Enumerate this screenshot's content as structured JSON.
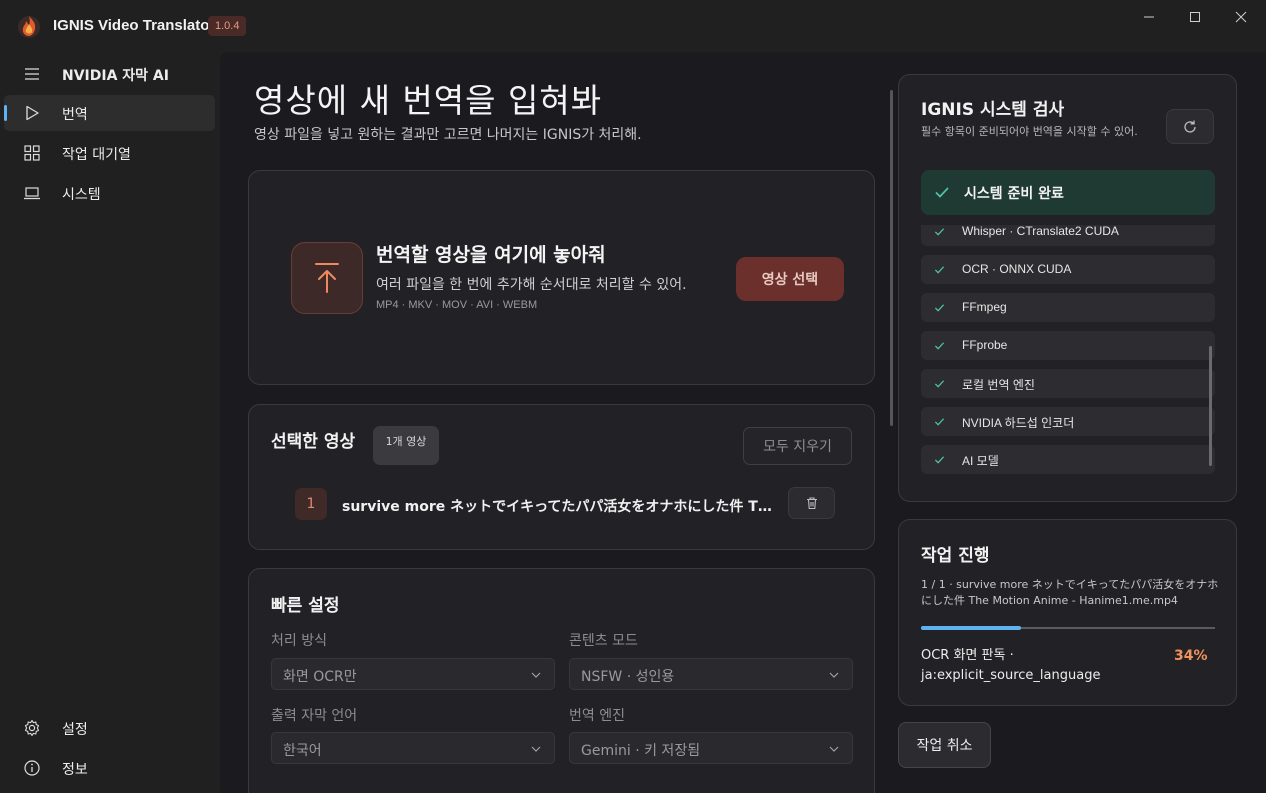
{
  "app": {
    "title": "IGNIS Video Translator",
    "version": "1.0.4"
  },
  "sidebar": {
    "header_label": "NVIDIA 자막 AI",
    "items": [
      {
        "label": "번역",
        "icon": "play-icon",
        "active": true
      },
      {
        "label": "작업 대기열",
        "icon": "grid-icon"
      },
      {
        "label": "시스템",
        "icon": "laptop-icon"
      }
    ],
    "footer": [
      {
        "label": "설정",
        "icon": "gear-icon"
      },
      {
        "label": "정보",
        "icon": "info-icon"
      }
    ]
  },
  "page": {
    "title": "영상에 새 번역을 입혀봐",
    "subtitle": "영상 파일을 넣고 원하는 결과만 고르면 나머지는 IGNIS가 처리해."
  },
  "dropzone": {
    "title": "번역할 영상을 여기에 놓아줘",
    "description": "여러 파일을 한 번에 추가해 순서대로 처리할 수 있어.",
    "formats": "MP4 · MKV · MOV · AVI · WEBM",
    "button": "영상 선택"
  },
  "selected": {
    "title": "선택한 영상",
    "count": "1개 영상",
    "clear_button": "모두 지우기",
    "files": [
      {
        "index": "1",
        "name": "survive more ネットでイキってたパパ活女をオナホにした件 The Motion Anime - Hanime1.me.mp4"
      }
    ]
  },
  "quick_settings": {
    "title": "빠른 설정",
    "fields": [
      {
        "label": "처리 방식",
        "value": "화면 OCR만"
      },
      {
        "label": "콘텐츠 모드",
        "value": "NSFW · 성인용"
      },
      {
        "label": "출력 자막 언어",
        "value": "한국어"
      },
      {
        "label": "번역 엔진",
        "value": "Gemini · 키 저장됨"
      }
    ]
  },
  "system_check": {
    "title": "IGNIS 시스템 검사",
    "description": "필수 항목이 준비되어야 번역을 시작할 수 있어.",
    "status": "시스템 준비 완료",
    "items": [
      "Whisper · CTranslate2 CUDA",
      "OCR · ONNX CUDA",
      "FFmpeg",
      "FFprobe",
      "로컬 번역 엔진",
      "NVIDIA 하드섭 인코더",
      "AI 모델"
    ]
  },
  "progress": {
    "title": "작업 진행",
    "file": "1 / 1 · survive more ネットでイキってたパパ活女をオナホにした件 The Motion Anime - Hanime1.me.mp4",
    "stage": "OCR 화면 판독 · ja:explicit_source_language",
    "percent_label": "34%",
    "fraction": 0.34,
    "cancel_button": "작업 취소"
  },
  "colors": {
    "accent": "#5fb2f2",
    "brand": "#6b302b",
    "ready": "#1f3a33",
    "check": "#4fc3a8",
    "percent": "#f0915e"
  }
}
